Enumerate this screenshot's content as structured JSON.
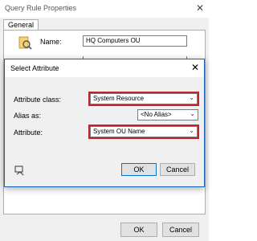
{
  "outer": {
    "title": "Query Rule Properties",
    "tab": "General",
    "name_label": "Name:",
    "name_value": "HQ Computers OU",
    "ok": "OK",
    "cancel": "Cancel"
  },
  "dialog": {
    "title": "Select Attribute",
    "attribute_class_label": "Attribute class:",
    "attribute_class_value": "System Resource",
    "alias_label": "Alias as:",
    "alias_value": "<No Alias>",
    "attribute_label": "Attribute:",
    "attribute_value": "System OU Name",
    "ok": "OK",
    "cancel": "Cancel"
  },
  "colors": {
    "highlight": "#c0252f",
    "accent": "#0078d7"
  }
}
